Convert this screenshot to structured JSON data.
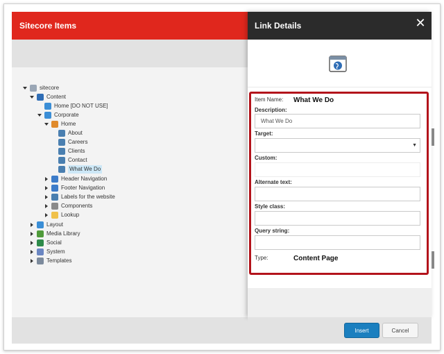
{
  "left_panel": {
    "title": "Sitecore Items",
    "tree": [
      {
        "label": "sitecore",
        "toggle": "down",
        "icon": "document-icon",
        "color": "#9aa6b5"
      },
      {
        "label": "Content",
        "toggle": "down",
        "icon": "content-icon",
        "color": "#2f6db5"
      },
      {
        "label": "Home [DO NOT USE]",
        "toggle": "none",
        "icon": "globe-icon",
        "color": "#3b8ed6"
      },
      {
        "label": "Corporate",
        "toggle": "down",
        "icon": "globe-icon",
        "color": "#3b8ed6"
      },
      {
        "label": "Home",
        "toggle": "down",
        "icon": "home-icon",
        "color": "#e08a2b"
      },
      {
        "label": "About",
        "toggle": "none",
        "icon": "page-icon",
        "color": "#4a7fb0"
      },
      {
        "label": "Careers",
        "toggle": "none",
        "icon": "page-icon",
        "color": "#4a7fb0"
      },
      {
        "label": "Clients",
        "toggle": "none",
        "icon": "page-icon",
        "color": "#4a7fb0"
      },
      {
        "label": "Contact",
        "toggle": "none",
        "icon": "page-icon",
        "color": "#4a7fb0"
      },
      {
        "label": "What We Do",
        "toggle": "none",
        "icon": "page-icon",
        "color": "#4a7fb0",
        "selected": true
      },
      {
        "label": "Header Navigation",
        "toggle": "right",
        "icon": "navigation-icon",
        "color": "#3d7cc9"
      },
      {
        "label": "Footer Navigation",
        "toggle": "right",
        "icon": "navigation-icon",
        "color": "#3d7cc9"
      },
      {
        "label": "Labels for the website",
        "toggle": "right",
        "icon": "labels-icon",
        "color": "#4a7fb0"
      },
      {
        "label": "Components",
        "toggle": "right",
        "icon": "components-icon",
        "color": "#8a8a8a"
      },
      {
        "label": "Lookup",
        "toggle": "right",
        "icon": "folder-icon",
        "color": "#f0c14b"
      },
      {
        "label": "Layout",
        "toggle": "right",
        "icon": "layout-icon",
        "color": "#3b8ed6"
      },
      {
        "label": "Media Library",
        "toggle": "right",
        "icon": "media-icon",
        "color": "#4f9a3a"
      },
      {
        "label": "Social",
        "toggle": "right",
        "icon": "social-icon",
        "color": "#2d8a4a"
      },
      {
        "label": "System",
        "toggle": "right",
        "icon": "system-icon",
        "color": "#6a86c2"
      },
      {
        "label": "Templates",
        "toggle": "right",
        "icon": "templates-icon",
        "color": "#7c8a9c"
      }
    ]
  },
  "dialog": {
    "title": "Link Details",
    "close_glyph": "✕",
    "fields": {
      "item_name_label": "Item Name:",
      "item_name_value": "What We Do",
      "description_label": "Description:",
      "description_value": "What We Do",
      "target_label": "Target:",
      "target_value": "",
      "custom_label": "Custom:",
      "custom_value": "",
      "alternate_text_label": "Alternate text:",
      "alternate_text_value": "",
      "style_class_label": "Style class:",
      "style_class_value": "",
      "query_string_label": "Query string:",
      "query_string_value": "",
      "type_label": "Type:",
      "type_value": "Content Page"
    },
    "buttons": {
      "insert": "Insert",
      "cancel": "Cancel"
    }
  },
  "colors": {
    "header_red": "#e0271d",
    "dialog_header": "#2b2b2b",
    "highlight_box": "#b3131b",
    "insert_button": "#1b7fbf"
  }
}
